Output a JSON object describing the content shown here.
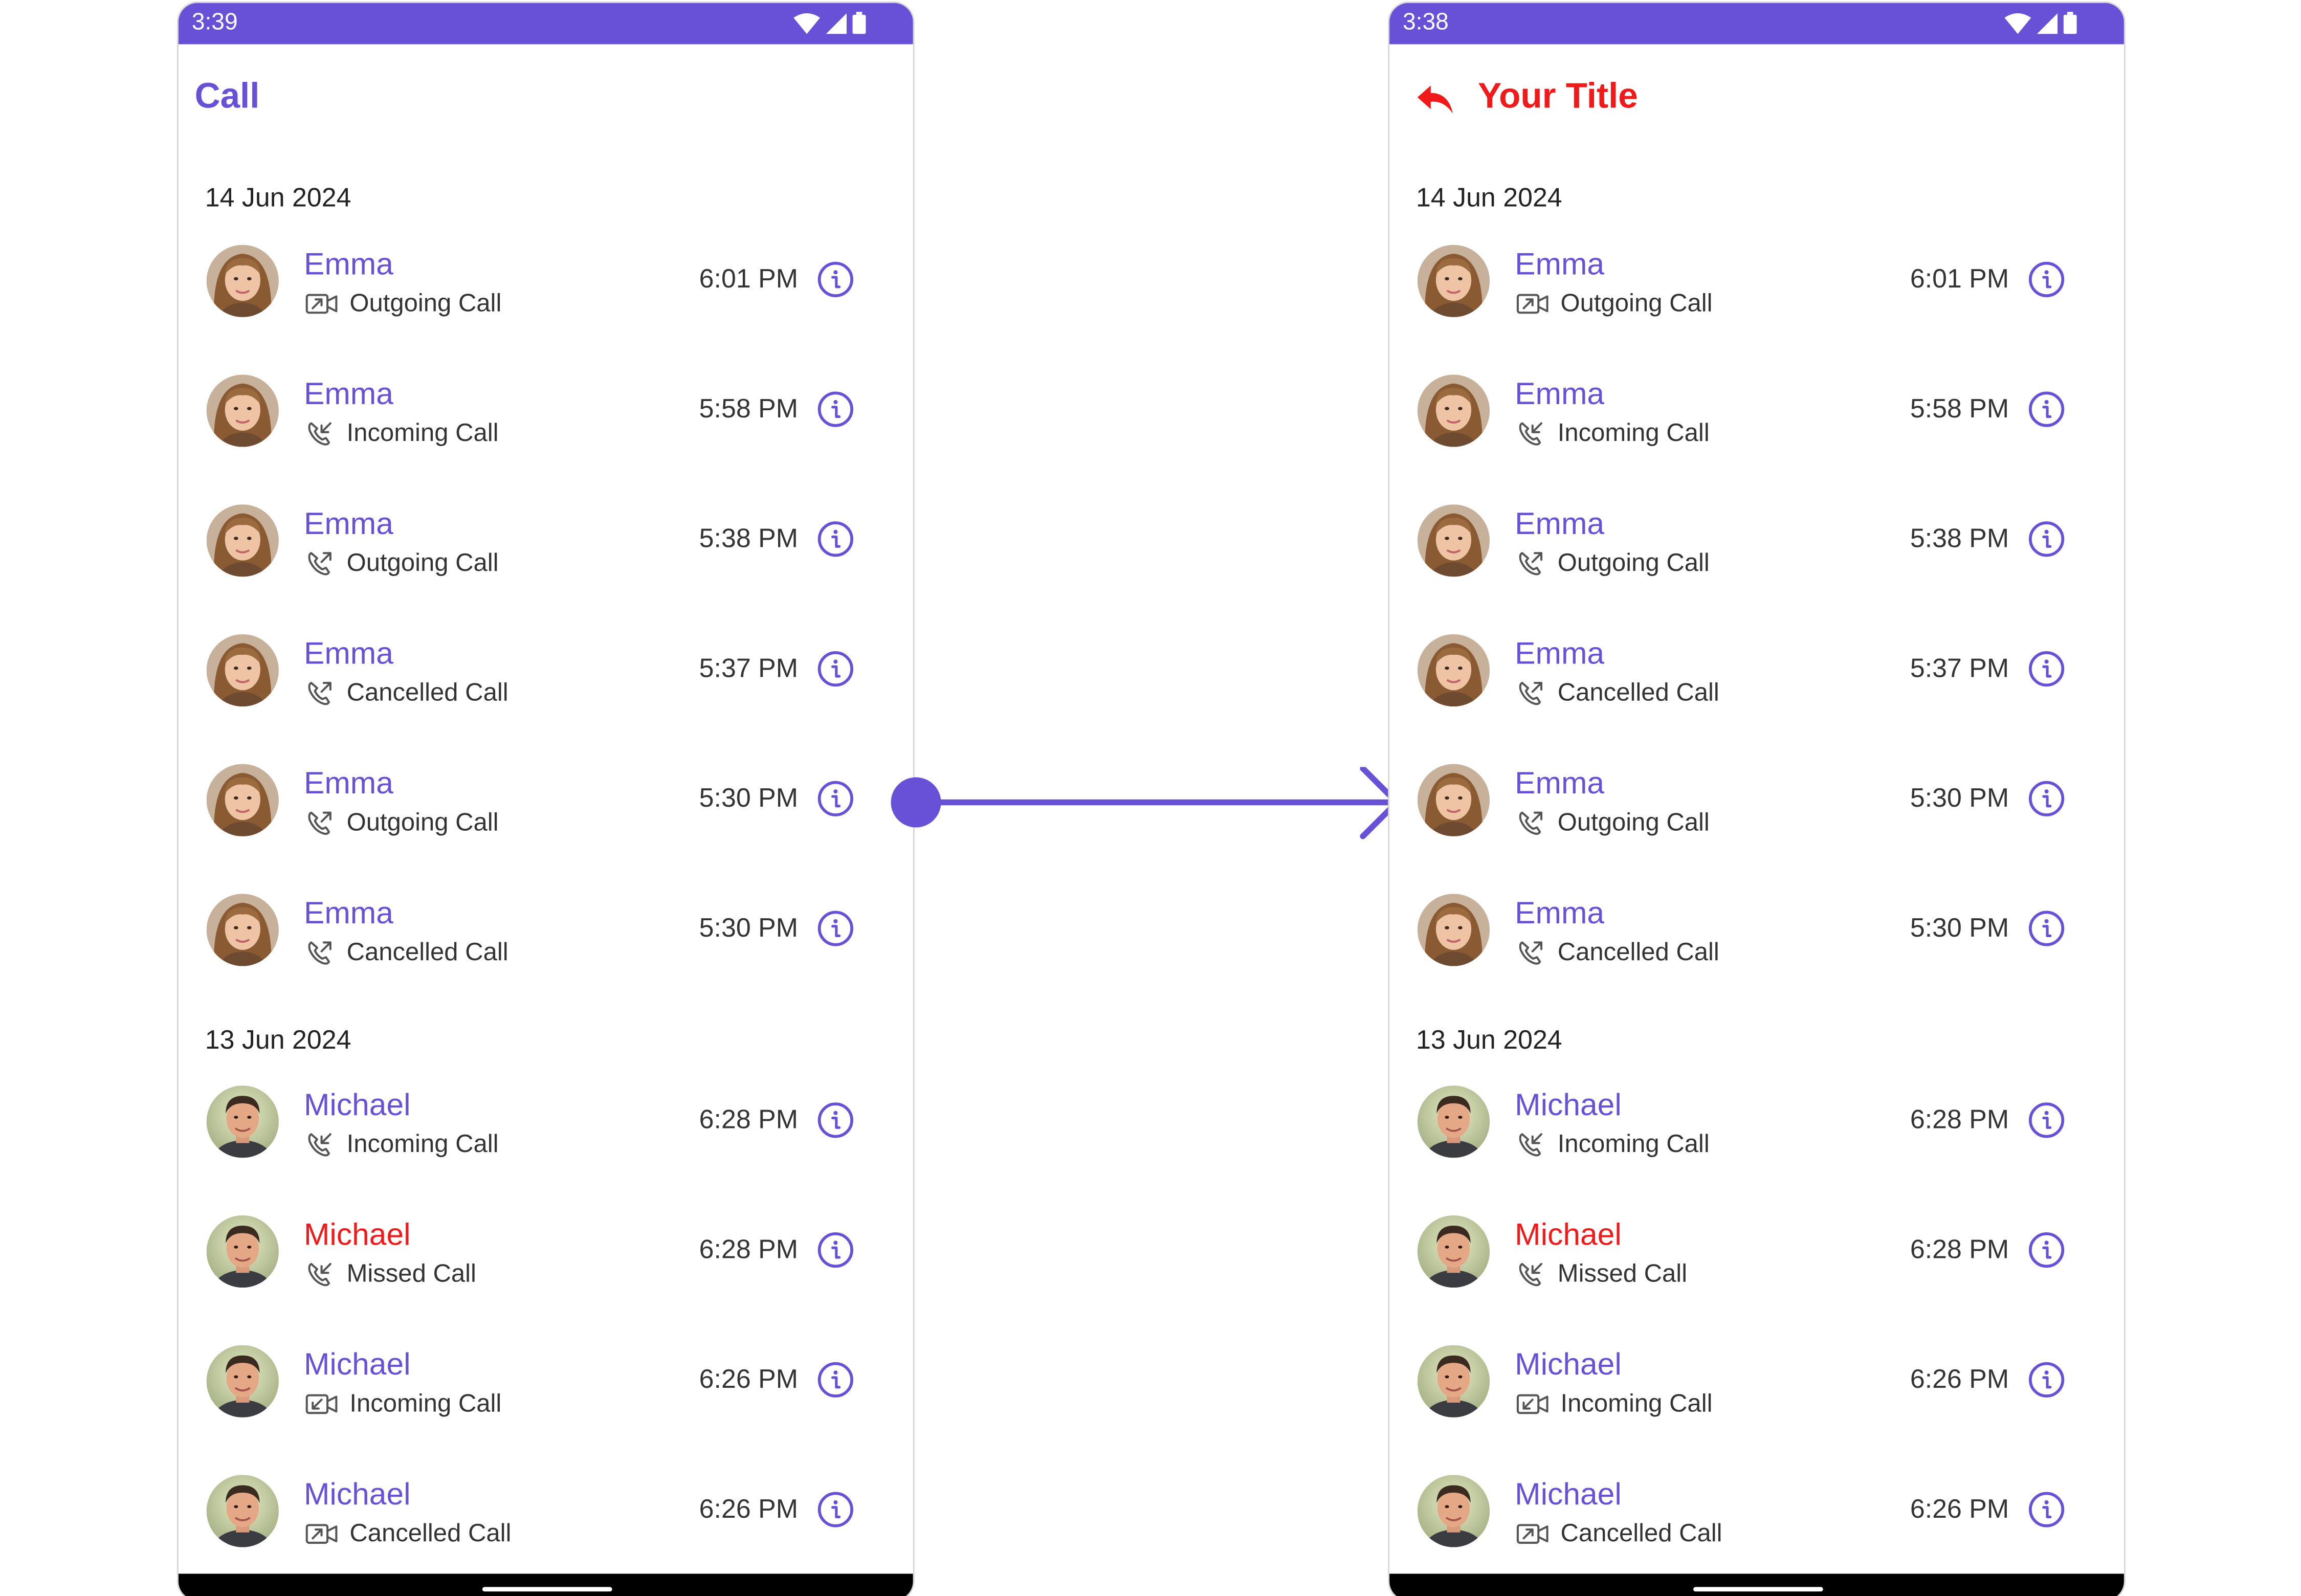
{
  "accent_color": "#6851D6",
  "missed_color": "#F11A1A",
  "left": {
    "status_time": "3:39",
    "title": "Call",
    "groups": [
      {
        "date": "14 Jun 2024",
        "calls": [
          {
            "name": "Emma",
            "type": "Outgoing Call",
            "icon": "video-outgoing-icon",
            "time": "6:01 PM",
            "missed": false
          },
          {
            "name": "Emma",
            "type": "Incoming Call",
            "icon": "audio-incoming-icon",
            "time": "5:58 PM",
            "missed": false
          },
          {
            "name": "Emma",
            "type": "Outgoing Call",
            "icon": "audio-outgoing-icon",
            "time": "5:38 PM",
            "missed": false
          },
          {
            "name": "Emma",
            "type": "Cancelled Call",
            "icon": "audio-outgoing-icon",
            "time": "5:37 PM",
            "missed": false
          },
          {
            "name": "Emma",
            "type": "Outgoing Call",
            "icon": "audio-outgoing-icon",
            "time": "5:30 PM",
            "missed": false
          },
          {
            "name": "Emma",
            "type": "Cancelled Call",
            "icon": "audio-outgoing-icon",
            "time": "5:30 PM",
            "missed": false
          }
        ]
      },
      {
        "date": "13 Jun 2024",
        "calls": [
          {
            "name": "Michael",
            "type": "Incoming Call",
            "icon": "audio-incoming-icon",
            "time": "6:28 PM",
            "missed": false
          },
          {
            "name": "Michael",
            "type": "Missed Call",
            "icon": "audio-incoming-icon",
            "time": "6:28 PM",
            "missed": true
          },
          {
            "name": "Michael",
            "type": "Incoming Call",
            "icon": "video-incoming-icon",
            "time": "6:26 PM",
            "missed": false
          },
          {
            "name": "Michael",
            "type": "Cancelled Call",
            "icon": "video-outgoing-icon",
            "time": "6:26 PM",
            "missed": false
          }
        ]
      }
    ]
  },
  "right": {
    "status_time": "3:38",
    "title": "Your Title",
    "groups": [
      {
        "date": "14 Jun 2024",
        "calls": [
          {
            "name": "Emma",
            "type": "Outgoing Call",
            "icon": "video-outgoing-icon",
            "time": "6:01 PM",
            "missed": false
          },
          {
            "name": "Emma",
            "type": "Incoming Call",
            "icon": "audio-incoming-icon",
            "time": "5:58 PM",
            "missed": false
          },
          {
            "name": "Emma",
            "type": "Outgoing Call",
            "icon": "audio-outgoing-icon",
            "time": "5:38 PM",
            "missed": false
          },
          {
            "name": "Emma",
            "type": "Cancelled Call",
            "icon": "audio-outgoing-icon",
            "time": "5:37 PM",
            "missed": false
          },
          {
            "name": "Emma",
            "type": "Outgoing Call",
            "icon": "audio-outgoing-icon",
            "time": "5:30 PM",
            "missed": false
          },
          {
            "name": "Emma",
            "type": "Cancelled Call",
            "icon": "audio-outgoing-icon",
            "time": "5:30 PM",
            "missed": false
          }
        ]
      },
      {
        "date": "13 Jun 2024",
        "calls": [
          {
            "name": "Michael",
            "type": "Incoming Call",
            "icon": "audio-incoming-icon",
            "time": "6:28 PM",
            "missed": false
          },
          {
            "name": "Michael",
            "type": "Missed Call",
            "icon": "audio-incoming-icon",
            "time": "6:28 PM",
            "missed": true
          },
          {
            "name": "Michael",
            "type": "Incoming Call",
            "icon": "video-incoming-icon",
            "time": "6:26 PM",
            "missed": false
          },
          {
            "name": "Michael",
            "type": "Cancelled Call",
            "icon": "video-outgoing-icon",
            "time": "6:26 PM",
            "missed": false
          }
        ]
      }
    ]
  }
}
